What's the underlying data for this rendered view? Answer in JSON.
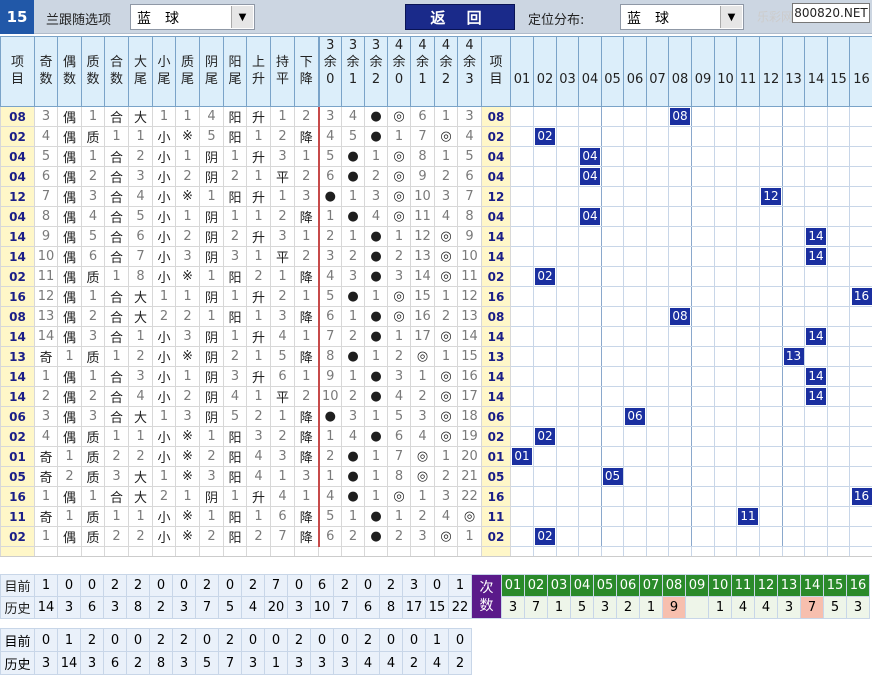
{
  "topbar": {
    "issue": "15",
    "filter_label": "兰跟随选项",
    "filter_value": "蓝　球",
    "back_label": "返 回",
    "dist_label": "定位分布:",
    "dist_value": "蓝　球",
    "site_text": "乐彩网",
    "site_badge": "800820.NET"
  },
  "headers": [
    "项目",
    "奇数",
    "偶数",
    "质数",
    "合数",
    "大尾",
    "小尾",
    "质尾",
    "阴尾",
    "阳尾",
    "上升",
    "持平",
    "下降",
    "3余0",
    "3余1",
    "3余2",
    "4余0",
    "4余1",
    "4余2",
    "4余3",
    "项目"
  ],
  "number_headers": [
    "01",
    "02",
    "03",
    "04",
    "05",
    "06",
    "07",
    "08",
    "09",
    "10",
    "11",
    "12",
    "13",
    "14",
    "15",
    "16"
  ],
  "rows": [
    {
      "item": "08",
      "c": [
        "3",
        "偶",
        "1",
        "合",
        "大",
        "1",
        "1",
        "4",
        "阳",
        "升",
        "1",
        "2",
        "3",
        "4",
        "●",
        "◎",
        "6",
        "1",
        "3"
      ]
    },
    {
      "item": "02",
      "c": [
        "4",
        "偶",
        "质",
        "1",
        "1",
        "小",
        "※",
        "5",
        "阳",
        "1",
        "2",
        "降",
        "4",
        "5",
        "●",
        "1",
        "7",
        "◎",
        "4"
      ]
    },
    {
      "item": "04",
      "c": [
        "5",
        "偶",
        "1",
        "合",
        "2",
        "小",
        "1",
        "阴",
        "1",
        "升",
        "3",
        "1",
        "5",
        "●",
        "1",
        "◎",
        "8",
        "1",
        "5"
      ]
    },
    {
      "item": "04",
      "c": [
        "6",
        "偶",
        "2",
        "合",
        "3",
        "小",
        "2",
        "阴",
        "2",
        "1",
        "平",
        "2",
        "6",
        "●",
        "2",
        "◎",
        "9",
        "2",
        "6"
      ]
    },
    {
      "item": "12",
      "c": [
        "7",
        "偶",
        "3",
        "合",
        "4",
        "小",
        "※",
        "1",
        "阳",
        "升",
        "1",
        "3",
        "●",
        "1",
        "3",
        "◎",
        "10",
        "3",
        "7"
      ]
    },
    {
      "item": "04",
      "c": [
        "8",
        "偶",
        "4",
        "合",
        "5",
        "小",
        "1",
        "阴",
        "1",
        "1",
        "2",
        "降",
        "1",
        "●",
        "4",
        "◎",
        "11",
        "4",
        "8"
      ]
    },
    {
      "item": "14",
      "c": [
        "9",
        "偶",
        "5",
        "合",
        "6",
        "小",
        "2",
        "阴",
        "2",
        "升",
        "3",
        "1",
        "2",
        "1",
        "●",
        "1",
        "12",
        "◎",
        "9"
      ]
    },
    {
      "item": "14",
      "c": [
        "10",
        "偶",
        "6",
        "合",
        "7",
        "小",
        "3",
        "阴",
        "3",
        "1",
        "平",
        "2",
        "3",
        "2",
        "●",
        "2",
        "13",
        "◎",
        "10"
      ]
    },
    {
      "item": "02",
      "c": [
        "11",
        "偶",
        "质",
        "1",
        "8",
        "小",
        "※",
        "1",
        "阳",
        "2",
        "1",
        "降",
        "4",
        "3",
        "●",
        "3",
        "14",
        "◎",
        "11"
      ]
    },
    {
      "item": "16",
      "c": [
        "12",
        "偶",
        "1",
        "合",
        "大",
        "1",
        "1",
        "阴",
        "1",
        "升",
        "2",
        "1",
        "5",
        "●",
        "1",
        "◎",
        "15",
        "1",
        "12"
      ]
    },
    {
      "item": "08",
      "c": [
        "13",
        "偶",
        "2",
        "合",
        "大",
        "2",
        "2",
        "1",
        "阳",
        "1",
        "3",
        "降",
        "6",
        "1",
        "●",
        "◎",
        "16",
        "2",
        "13"
      ]
    },
    {
      "item": "14",
      "c": [
        "14",
        "偶",
        "3",
        "合",
        "1",
        "小",
        "3",
        "阴",
        "1",
        "升",
        "4",
        "1",
        "7",
        "2",
        "●",
        "1",
        "17",
        "◎",
        "14"
      ]
    },
    {
      "item": "13",
      "c": [
        "奇",
        "1",
        "质",
        "1",
        "2",
        "小",
        "※",
        "阴",
        "2",
        "1",
        "5",
        "降",
        "8",
        "●",
        "1",
        "2",
        "◎",
        "1",
        "15"
      ]
    },
    {
      "item": "14",
      "c": [
        "1",
        "偶",
        "1",
        "合",
        "3",
        "小",
        "1",
        "阴",
        "3",
        "升",
        "6",
        "1",
        "9",
        "1",
        "●",
        "3",
        "1",
        "◎",
        "16"
      ]
    },
    {
      "item": "14",
      "c": [
        "2",
        "偶",
        "2",
        "合",
        "4",
        "小",
        "2",
        "阴",
        "4",
        "1",
        "平",
        "2",
        "10",
        "2",
        "●",
        "4",
        "2",
        "◎",
        "17"
      ]
    },
    {
      "item": "06",
      "c": [
        "3",
        "偶",
        "3",
        "合",
        "大",
        "1",
        "3",
        "阴",
        "5",
        "2",
        "1",
        "降",
        "●",
        "3",
        "1",
        "5",
        "3",
        "◎",
        "18"
      ]
    },
    {
      "item": "02",
      "c": [
        "4",
        "偶",
        "质",
        "1",
        "1",
        "小",
        "※",
        "1",
        "阳",
        "3",
        "2",
        "降",
        "1",
        "4",
        "●",
        "6",
        "4",
        "◎",
        "19"
      ]
    },
    {
      "item": "01",
      "c": [
        "奇",
        "1",
        "质",
        "2",
        "2",
        "小",
        "※",
        "2",
        "阳",
        "4",
        "3",
        "降",
        "2",
        "●",
        "1",
        "7",
        "◎",
        "1",
        "20"
      ]
    },
    {
      "item": "05",
      "c": [
        "奇",
        "2",
        "质",
        "3",
        "大",
        "1",
        "※",
        "3",
        "阳",
        "4",
        "1",
        "3",
        "1",
        "●",
        "1",
        "8",
        "◎",
        "2",
        "21"
      ]
    },
    {
      "item": "16",
      "c": [
        "1",
        "偶",
        "1",
        "合",
        "大",
        "2",
        "1",
        "阴",
        "1",
        "升",
        "4",
        "1",
        "4",
        "●",
        "1",
        "◎",
        "1",
        "3",
        "22"
      ]
    },
    {
      "item": "11",
      "c": [
        "奇",
        "1",
        "质",
        "1",
        "1",
        "小",
        "※",
        "1",
        "阳",
        "1",
        "6",
        "降",
        "5",
        "1",
        "●",
        "1",
        "2",
        "4",
        "◎"
      ]
    },
    {
      "item": "02",
      "c": [
        "1",
        "偶",
        "质",
        "2",
        "2",
        "小",
        "※",
        "2",
        "阳",
        "2",
        "7",
        "降",
        "6",
        "2",
        "●",
        "2",
        "3",
        "◎",
        "1"
      ]
    }
  ],
  "bottom": {
    "now_label": "目前",
    "hist_label": "历史",
    "cishu_label": "次数",
    "now_values": [
      "1",
      "0",
      "0",
      "2",
      "2",
      "0",
      "0",
      "2",
      "0",
      "2",
      "7",
      "0",
      "6",
      "2",
      "0",
      "2",
      "3",
      "0",
      "1"
    ],
    "hist_values": [
      "14",
      "3",
      "6",
      "3",
      "8",
      "2",
      "3",
      "7",
      "5",
      "4",
      "20",
      "3",
      "10",
      "7",
      "6",
      "8",
      "17",
      "15",
      "22"
    ],
    "num_counts": [
      "3",
      "7",
      "1",
      "5",
      "3",
      "2",
      "1",
      "9",
      "",
      "1",
      "4",
      "4",
      "3",
      "7",
      "5",
      "3"
    ],
    "now2_values": [
      "0",
      "1",
      "2",
      "0",
      "0",
      "2",
      "2",
      "0",
      "2",
      "0",
      "0",
      "2",
      "0",
      "0",
      "2",
      "0",
      "0",
      "1",
      "0"
    ],
    "hist2_values": [
      "3",
      "14",
      "3",
      "6",
      "2",
      "8",
      "3",
      "5",
      "7",
      "3",
      "1",
      "3",
      "3",
      "3",
      "4",
      "4",
      "2",
      "4",
      "2"
    ]
  },
  "colors": {
    "accent": "#1a2fa0",
    "header_bg": "#dceefa",
    "item_bg": "#fff7c8",
    "back_bg": "#1a2a8a",
    "cishu_bg": "#5a1a8a",
    "green_head": "#2a8a2a",
    "highlight": "#f7bfae"
  }
}
